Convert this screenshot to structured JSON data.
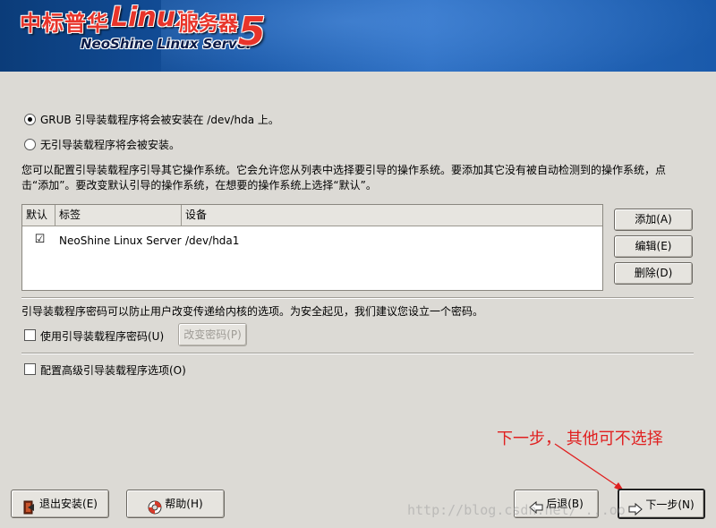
{
  "banner": {
    "logo_cn": "中标普华",
    "logo_linux": "Linux",
    "logo_cn2": "服务器",
    "logo_en": "NeoShine Linux Server",
    "logo_version": "5"
  },
  "bootloader": {
    "option_grub": "GRUB 引导装载程序将会被安装在 /dev/hda 上。",
    "option_none": "无引导装载程序将会被安装。",
    "selected": "option_grub",
    "description": "您可以配置引导装载程序引导其它操作系统。它会允许您从列表中选择要引导的操作系统。要添加其它没有被自动检测到的操作系统，点击“添加”。要改变默认引导的操作系统，在想要的操作系统上选择“默认”。"
  },
  "table": {
    "columns": [
      "默认",
      "标签",
      "设备"
    ],
    "rows": [
      {
        "default": true,
        "label": "NeoShine Linux Server",
        "device": "/dev/hda1"
      }
    ]
  },
  "side_buttons": {
    "add": "添加(A)",
    "edit": "编辑(E)",
    "delete": "删除(D)"
  },
  "password": {
    "description": "引导装载程序密码可以防止用户改变传递给内核的选项。为安全起见，我们建议您设立一个密码。",
    "use_password_label": "使用引导装载程序密码(U)",
    "use_password_checked": false,
    "change_password": "改变密码(P)"
  },
  "advanced": {
    "label": "配置高级引导装载程序选项(O)",
    "checked": false
  },
  "footer": {
    "exit": "退出安装(E)",
    "help": "帮助(H)",
    "back": "后退(B)",
    "next": "下一步(N)"
  },
  "annotation": "下一步，  其他可不选择",
  "watermark": "http://blog.csdn.net/ ...oo"
}
